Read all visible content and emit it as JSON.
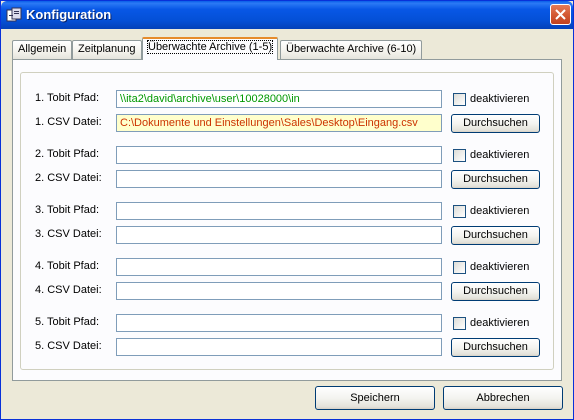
{
  "window": {
    "title": "Konfiguration"
  },
  "tabs": [
    {
      "label": "Allgemein"
    },
    {
      "label": "Zeitplanung"
    },
    {
      "label": "Überwachte Archive (1-5)"
    },
    {
      "label": "Überwachte Archive (6-10)"
    }
  ],
  "active_tab_index": 2,
  "rows": [
    {
      "tobit_label": "1. Tobit Pfad:",
      "csv_label": "1. CSV Datei:",
      "tobit_value": "\\\\ita2\\david\\archive\\user\\10028000\\in",
      "csv_value": "C:\\Dokumente und Einstellungen\\Sales\\Desktop\\Eingang.csv",
      "deactivate_label": "deaktivieren",
      "browse_label": "Durchsuchen"
    },
    {
      "tobit_label": "2. Tobit Pfad:",
      "csv_label": "2. CSV Datei:",
      "tobit_value": "",
      "csv_value": "",
      "deactivate_label": "deaktivieren",
      "browse_label": "Durchsuchen"
    },
    {
      "tobit_label": "3. Tobit Pfad:",
      "csv_label": "3. CSV Datei:",
      "tobit_value": "",
      "csv_value": "",
      "deactivate_label": "deaktivieren",
      "browse_label": "Durchsuchen"
    },
    {
      "tobit_label": "4. Tobit Pfad:",
      "csv_label": "4. CSV Datei:",
      "tobit_value": "",
      "csv_value": "",
      "deactivate_label": "deaktivieren",
      "browse_label": "Durchsuchen"
    },
    {
      "tobit_label": "5. Tobit Pfad:",
      "csv_label": "5. CSV Datei:",
      "tobit_value": "",
      "csv_value": "",
      "deactivate_label": "deaktivieren",
      "browse_label": "Durchsuchen"
    }
  ],
  "footer": {
    "save_label": "Speichern",
    "cancel_label": "Abbrechen"
  },
  "colors": {
    "titlebar": "#0450d6",
    "tobit_text": "#009900",
    "csv_text": "#cc3300",
    "csv_bg": "#ffffcc"
  }
}
